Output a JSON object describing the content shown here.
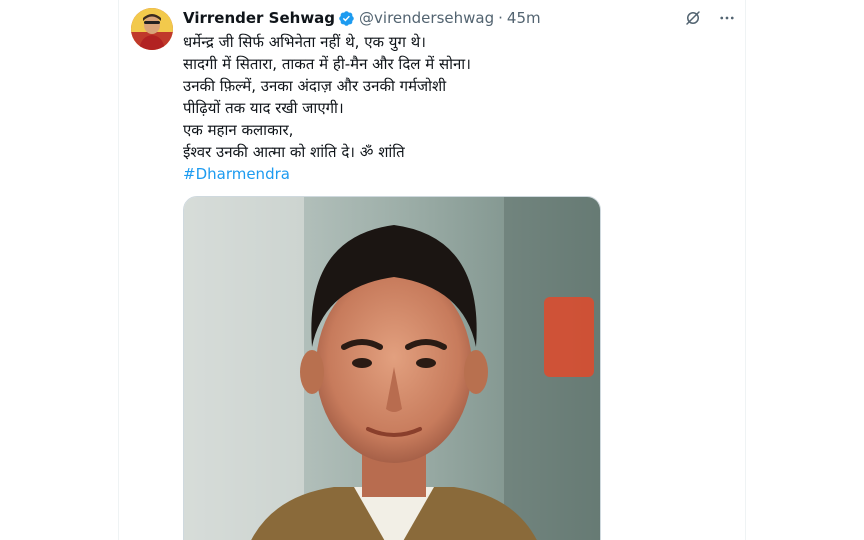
{
  "tweet": {
    "display_name": "Virrender Sehwag",
    "handle": "@virendersehwag",
    "separator": "·",
    "time": "45m",
    "lines": [
      "धर्मेन्द्र जी सिर्फ अभिनेता नहीं थे, एक युग थे।",
      "सादगी में सितारा, ताकत में ही-मैन और दिल में सोना।",
      "उनकी फ़िल्में, उनका अंदाज़ और उनकी गर्मजोशी",
      "पीढ़ियों तक याद रखी जाएगी।",
      "एक महान कलाकार,",
      "ईश्वर उनकी आत्मा को शांति दे। ॐ शांति"
    ],
    "hashtag": "#Dharmendra"
  },
  "icons": {
    "verified": "verified-badge-icon",
    "grok": "grok-icon",
    "more": "more-icon"
  },
  "colors": {
    "accent": "#1d9bf0",
    "text": "#0f1419",
    "muted": "#536471"
  }
}
